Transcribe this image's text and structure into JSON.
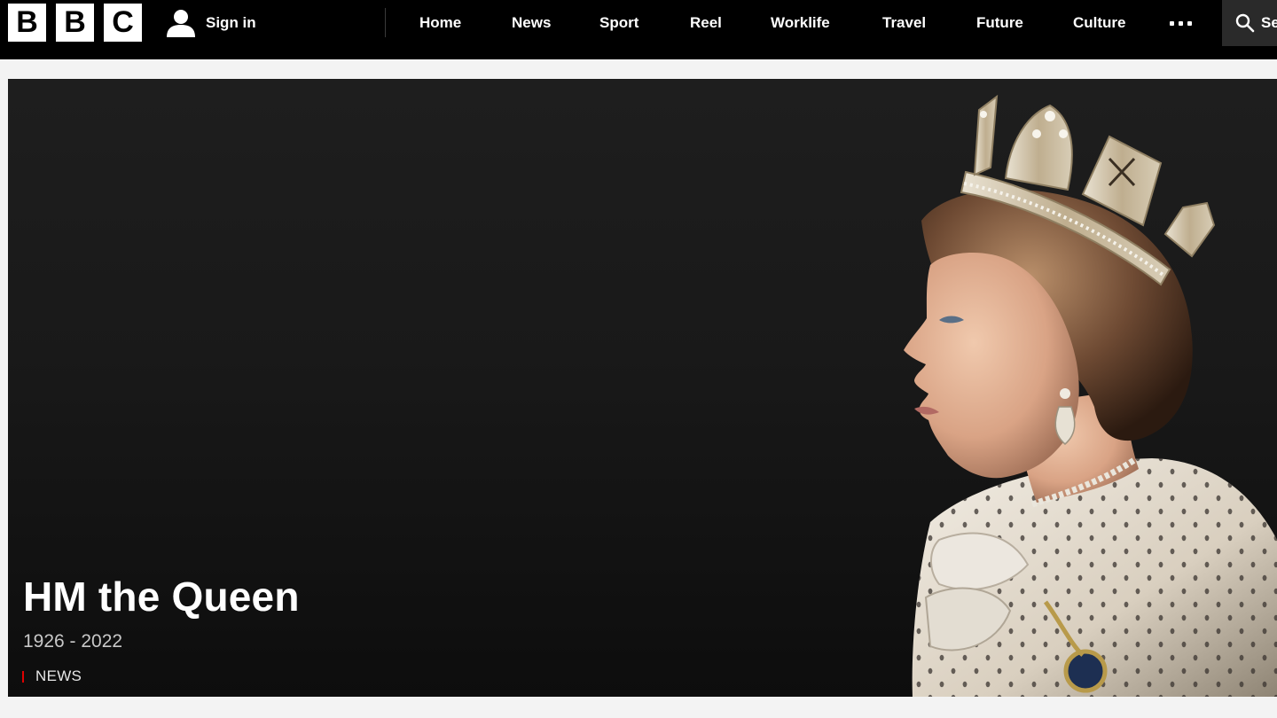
{
  "logo": {
    "letters": [
      "B",
      "B",
      "C"
    ]
  },
  "account": {
    "signin_label": "Sign in",
    "icon": "user-icon"
  },
  "nav": {
    "items": [
      {
        "label": "Home"
      },
      {
        "label": "News"
      },
      {
        "label": "Sport"
      },
      {
        "label": "Reel"
      },
      {
        "label": "Worklife"
      },
      {
        "label": "Travel"
      },
      {
        "label": "Future"
      },
      {
        "label": "Culture"
      }
    ],
    "more_icon": "more-dots-icon",
    "search_label": "Se",
    "search_icon": "search-icon"
  },
  "hero": {
    "title": "HM the Queen",
    "subtitle": "1926 - 2022",
    "tag": "NEWS",
    "tag_color": "#e00000",
    "image": "portrait of the Queen wearing a diamond crown"
  },
  "colors": {
    "topbar": "#000000",
    "page_background": "#f3f3f3",
    "hero_background": "#1b1b1b"
  }
}
